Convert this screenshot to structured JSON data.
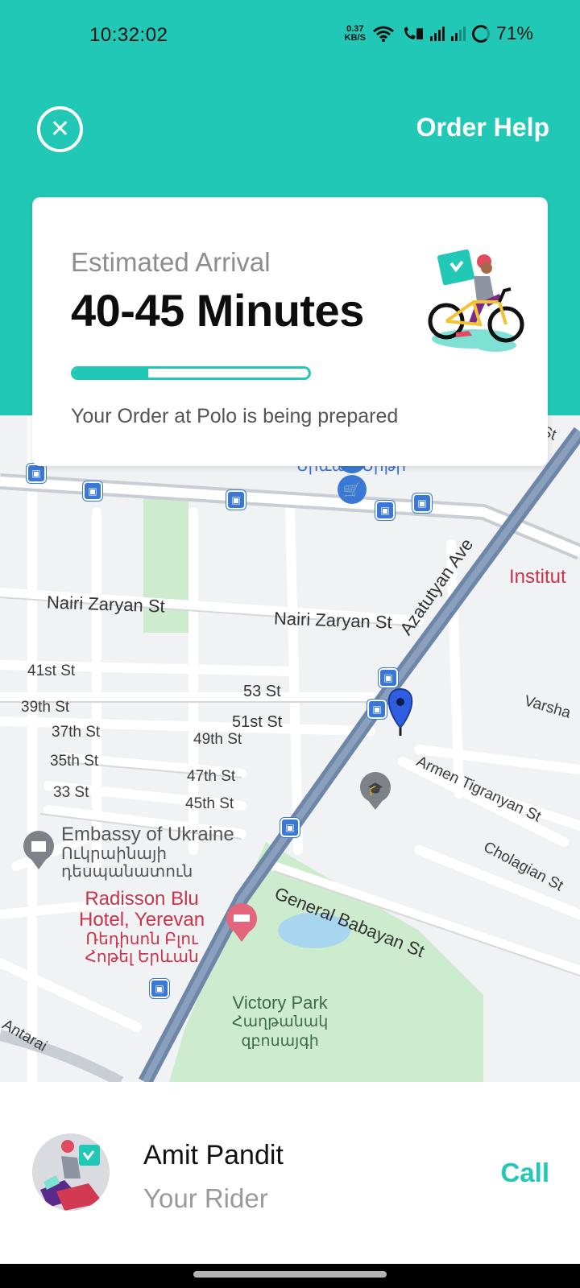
{
  "status_bar": {
    "time": "10:32:02",
    "net_speed_value": "0.37",
    "net_speed_unit": "KB/S",
    "battery": "71%",
    "icons": [
      "wifi-icon",
      "volte-call-icon",
      "signal-icon",
      "signal-weak-icon",
      "battery-ring-icon"
    ]
  },
  "header": {
    "close_icon": "close-icon",
    "order_help_label": "Order Help"
  },
  "eta_card": {
    "label": "Estimated Arrival",
    "value": "40-45 Minutes",
    "progress_fraction": 0.32,
    "status_text": "Your Order at Polo is being prepared",
    "illustration": "delivery-rider-bicycle-illustration"
  },
  "map": {
    "streets": {
      "nairi_1": "Nairi Zaryan St",
      "nairi_2": "Nairi Zaryan St",
      "azatutyan": "Azatutyan Ave",
      "armen": "Armen Tigranyan St",
      "cholagian": "Cholagian St",
      "babayan": "General Babayan St",
      "varsha": "Varsha",
      "st41": "41st St",
      "st39": "39th St",
      "st37": "37th St",
      "st35": "35th St",
      "st33": "33 St",
      "st53": "53 St",
      "st51": "51st St",
      "st49": "49th St",
      "st47": "47th St",
      "st45": "45th St",
      "st_corner": "St",
      "antarai": "Antarai"
    },
    "places": {
      "supermarket": "Երևան Սիթի",
      "institute": "Institut",
      "embassy_en": "Embassy of Ukraine",
      "embassy_hy_1": "Ուկրաինայի",
      "embassy_hy_2": "դեսպանատուն",
      "radisson_en_1": "Radisson Blu",
      "radisson_en_2": "Hotel, Yerevan",
      "radisson_hy_1": "Ռեդիսոն Բլու",
      "radisson_hy_2": "Հոթել Երևան",
      "park_en": "Victory Park",
      "park_hy_1": "Հաղթանակ",
      "park_hy_2": "զբոսայգի"
    },
    "marker_icon": "location-pin-icon",
    "accent_color": "#3a78d8"
  },
  "rider": {
    "name": "Amit Pandit",
    "role": "Your Rider",
    "call_label": "Call",
    "avatar": "rider-avatar-illustration"
  },
  "colors": {
    "brand": "#22c8b6",
    "map_bg": "#f1f2f4",
    "road": "#ffffff",
    "main_road": "#6e87a8",
    "park": "#cdeccd",
    "water": "#a9d6ef"
  }
}
